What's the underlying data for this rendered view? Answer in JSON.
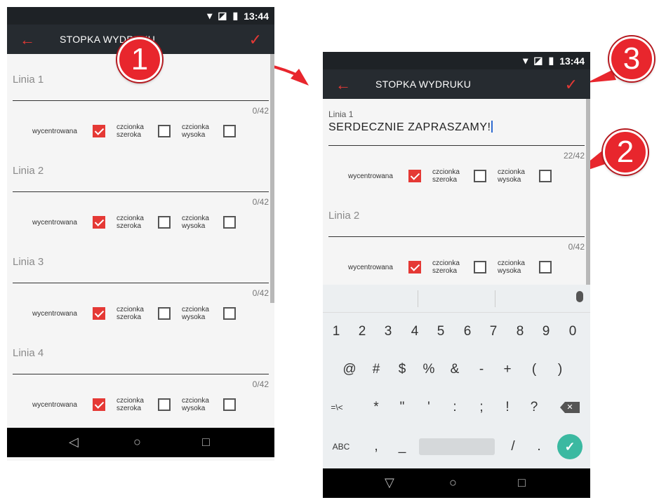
{
  "status_time": "13:44",
  "screen1": {
    "title": "STOPKA WYDRUKU",
    "lines": [
      {
        "placeholder": "Linia 1",
        "counter": "0/42"
      },
      {
        "placeholder": "Linia 2",
        "counter": "0/42"
      },
      {
        "placeholder": "Linia 3",
        "counter": "0/42"
      },
      {
        "placeholder": "Linia 4",
        "counter": "0/42"
      }
    ]
  },
  "screen2": {
    "title": "STOPKA WYDRUKU",
    "line1": {
      "label": "Linia 1",
      "value": "SERDECZNIE ZAPRASZAMY!",
      "counter": "22/42"
    },
    "line2": {
      "placeholder": "Linia 2",
      "counter": "0/42"
    }
  },
  "options": {
    "centered": "wycentrowana",
    "wide_1": "czcionka",
    "wide_2": "szeroka",
    "tall_1": "czcionka",
    "tall_2": "wysoka",
    "centered_checked": true,
    "wide_checked": false,
    "tall_checked": false
  },
  "keyboard": {
    "numbers": [
      "1",
      "2",
      "3",
      "4",
      "5",
      "6",
      "7",
      "8",
      "9",
      "0"
    ],
    "symbols1": [
      "@",
      "#",
      "$",
      "%",
      "&",
      "-",
      "+",
      "(",
      ")"
    ],
    "symbols2": [
      "=\\<",
      "*",
      "\"",
      "'",
      ":",
      ";",
      "!",
      "?"
    ],
    "bottom": [
      "ABC",
      ",",
      "_",
      "/",
      "."
    ]
  },
  "callouts": [
    "1",
    "2",
    "3"
  ],
  "icons": {
    "back": "arrow-left-icon",
    "confirm": "check-icon",
    "wifi": "wifi-icon",
    "battery": "battery-icon"
  }
}
